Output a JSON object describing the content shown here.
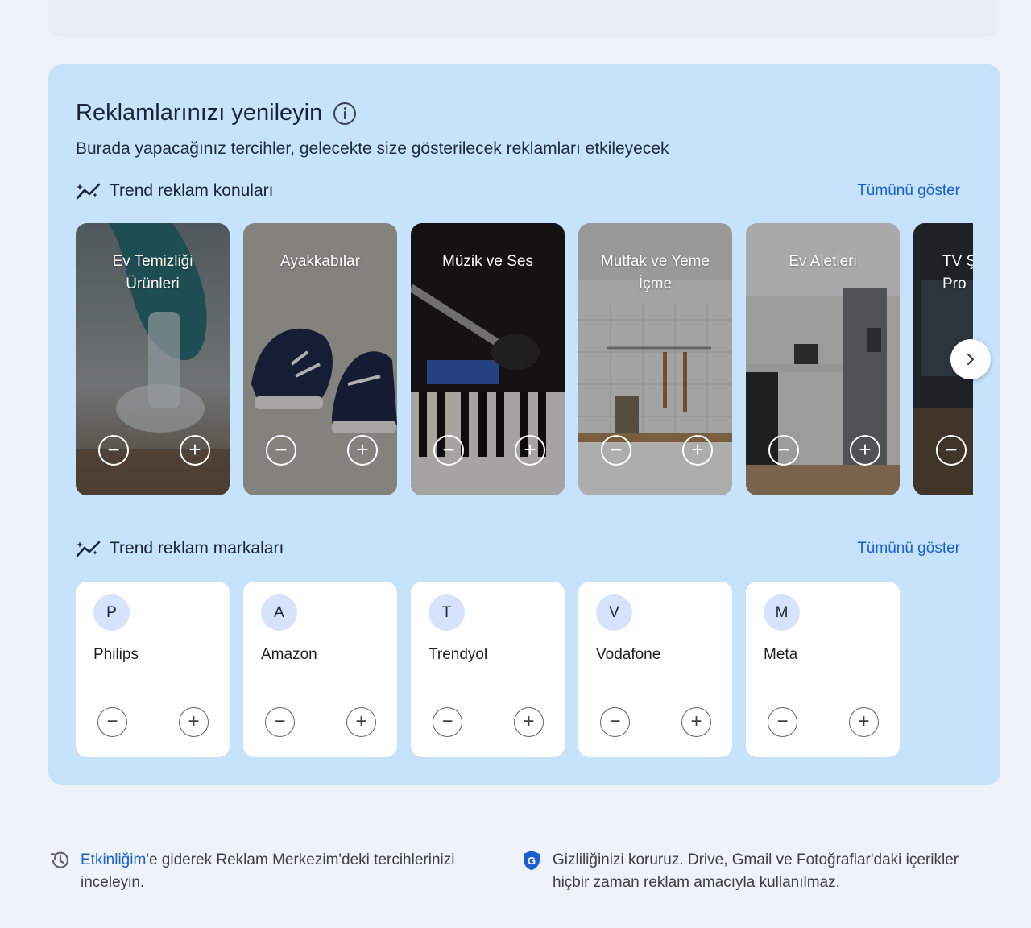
{
  "panel": {
    "title": "Reklamlarınızı yenileyin",
    "subtitle": "Burada yapacağınız tercihler, gelecekte size gösterilecek reklamları etkileyecek"
  },
  "topics": {
    "title": "Trend reklam konuları",
    "show_all": "Tümünü göster",
    "items": [
      {
        "label": "Ev Temizliği Ürünleri",
        "image": "cleaning-spray-photo"
      },
      {
        "label": "Ayakkabılar",
        "image": "sneakers-photo"
      },
      {
        "label": "Müzik ve Ses",
        "image": "microphone-keyboard-photo"
      },
      {
        "label": "Mutfak ve Yeme İçme",
        "image": "kitchen-utensils-photo"
      },
      {
        "label": "Ev Aletleri",
        "image": "kitchen-appliances-photo"
      },
      {
        "label": "TV Ş Pro",
        "image": "tv-photo"
      }
    ],
    "minus_symbol": "−",
    "plus_symbol": "+"
  },
  "brands": {
    "title": "Trend reklam markaları",
    "show_all": "Tümünü göster",
    "items": [
      {
        "initial": "P",
        "name": "Philips"
      },
      {
        "initial": "A",
        "name": "Amazon"
      },
      {
        "initial": "T",
        "name": "Trendyol"
      },
      {
        "initial": "V",
        "name": "Vodafone"
      },
      {
        "initial": "M",
        "name": "Meta"
      }
    ]
  },
  "footer": {
    "activity_link": "Etkinliğim",
    "activity_text": "'e giderek Reklam Merkezim'deki tercihlerinizi inceleyin.",
    "privacy_text": "Gizliliğinizi koruruz. Drive, Gmail ve Fotoğraflar'daki içerikler hiçbir zaman reklam amacıyla kullanılmaz."
  },
  "colors": {
    "panel_bg": "#c6e3fb",
    "link": "#1a5fd0",
    "avatar_bg": "#d7e3fc",
    "shield": "#1a5fd0"
  }
}
